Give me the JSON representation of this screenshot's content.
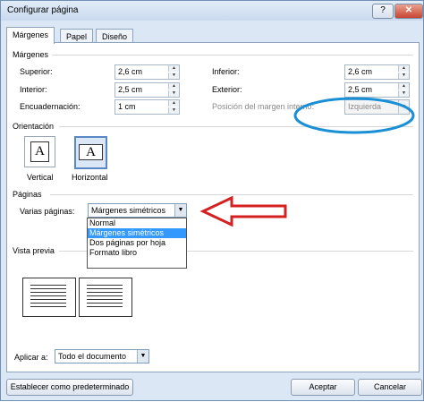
{
  "window": {
    "title": "Configurar página",
    "minimize_icon": "minimize-icon",
    "close_icon": "close-icon"
  },
  "tabs": [
    {
      "label": "Márgenes",
      "active": true
    },
    {
      "label": "Papel",
      "active": false
    },
    {
      "label": "Diseño",
      "active": false
    }
  ],
  "margins": {
    "section_title": "Márgenes",
    "superior_label": "Superior:",
    "superior_value": "2,6 cm",
    "inferior_label": "Inferior:",
    "inferior_value": "2,6 cm",
    "interior_label": "Interior:",
    "interior_value": "2,5 cm",
    "exterior_label": "Exterior:",
    "exterior_value": "2,5 cm",
    "encuadernacion_label": "Encuadernación:",
    "encuadernacion_value": "1 cm",
    "posicion_label": "Posición del margen interno:",
    "posicion_value": "Izquierda"
  },
  "orientation": {
    "section_title": "Orientación",
    "vertical_label": "Vertical",
    "horizontal_label": "Horizontal",
    "icon_letter": "A",
    "selected": "Horizontal"
  },
  "pages": {
    "section_title": "Páginas",
    "varias_label": "Varias páginas:",
    "selected_value": "Márgenes simétricos",
    "options": [
      "Normal",
      "Márgenes simétricos",
      "Dos páginas por hoja",
      "Formato libro"
    ]
  },
  "preview": {
    "section_title": "Vista previa"
  },
  "apply": {
    "label": "Aplicar a:",
    "value": "Todo el documento"
  },
  "buttons": {
    "default_label": "Establecer como predeterminado",
    "ok_label": "Aceptar",
    "cancel_label": "Cancelar"
  },
  "annotations": {
    "ellipse_color": "#1a8fd6",
    "arrow_color": "#d42020"
  }
}
